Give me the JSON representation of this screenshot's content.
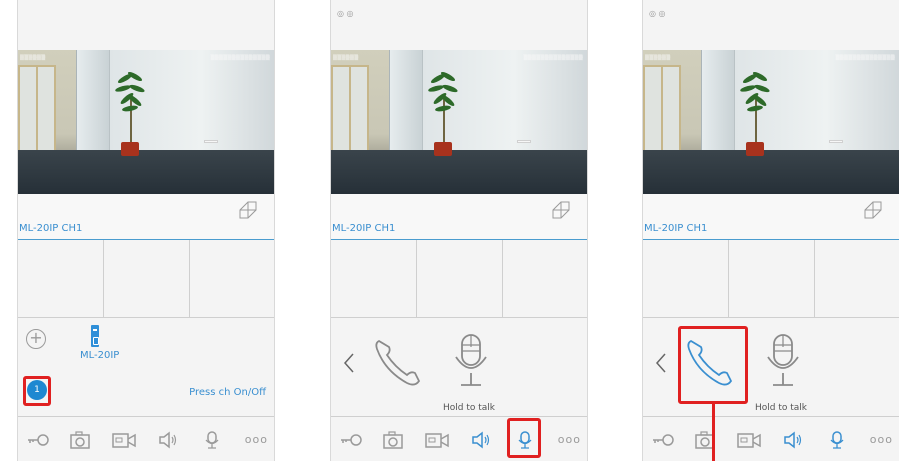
{
  "panels": [
    {
      "id": "panel-1",
      "channel_label": "ML-20IP CH1",
      "device_name": "ML-20IP",
      "channel_badge": "1",
      "press_text": "Press ch On/Off"
    },
    {
      "id": "panel-2",
      "channel_label": "ML-20IP CH1",
      "hold_text": "Hold to talk"
    },
    {
      "id": "panel-3",
      "channel_label": "ML-20IP CH1",
      "hold_text": "Hold to talk"
    }
  ],
  "toolbar": {
    "icons": [
      "key-icon",
      "camera-icon",
      "video-record-icon",
      "speaker-icon",
      "microphone-icon",
      "more-icon"
    ],
    "more_label": "ooo"
  },
  "colors": {
    "accent": "#3a8fd0",
    "highlight": "#e02020",
    "icon_gray": "#9a9a9a",
    "badge": "#1e88d1"
  }
}
